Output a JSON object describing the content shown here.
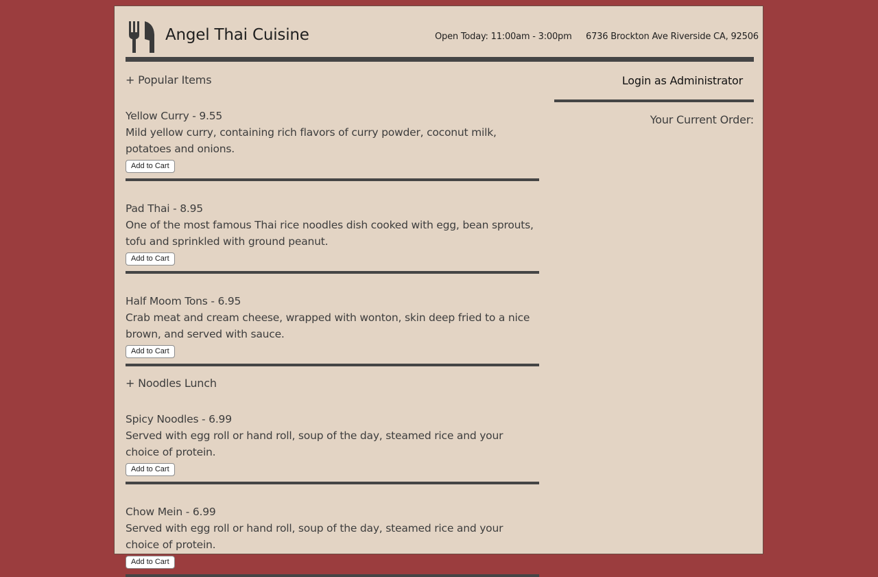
{
  "header": {
    "title": "Angel Thai Cuisine",
    "hours": "Open Today: 11:00am - 3:00pm",
    "address": "6736 Brockton Ave Riverside CA, 92506",
    "logo_icon": "fork-knife-icon"
  },
  "colors": {
    "background": "#9b3d3e",
    "page": "#e3d4c4",
    "rule": "#454545",
    "text": "#3d3d3d"
  },
  "menu": {
    "add_label": "Add to Cart",
    "sections": [
      {
        "heading": "+ Popular Items",
        "items": [
          {
            "title": "Yellow Curry - 9.55",
            "description": "Mild yellow curry, containing rich flavors of curry powder, coconut milk, potatoes and onions."
          },
          {
            "title": "Pad Thai - 8.95",
            "description": "One of the most famous Thai rice noodles dish cooked with egg, bean sprouts, tofu and sprinkled with ground peanut."
          },
          {
            "title": "Half Moom Tons - 6.95",
            "description": "Crab meat and cream cheese, wrapped with wonton, skin deep fried to a nice brown, and served with sauce."
          }
        ]
      },
      {
        "heading": "+ Noodles Lunch",
        "items": [
          {
            "title": "Spicy Noodles - 6.99",
            "description": "Served with egg roll or hand roll, soup of the day, steamed rice and your choice of protein."
          },
          {
            "title": "Chow Mein - 6.99",
            "description": "Served with egg roll or hand roll, soup of the day, steamed rice and your choice of protein."
          }
        ]
      }
    ]
  },
  "sidebar": {
    "admin_label": "Login as Administrator",
    "order_label": "Your Current Order:"
  }
}
